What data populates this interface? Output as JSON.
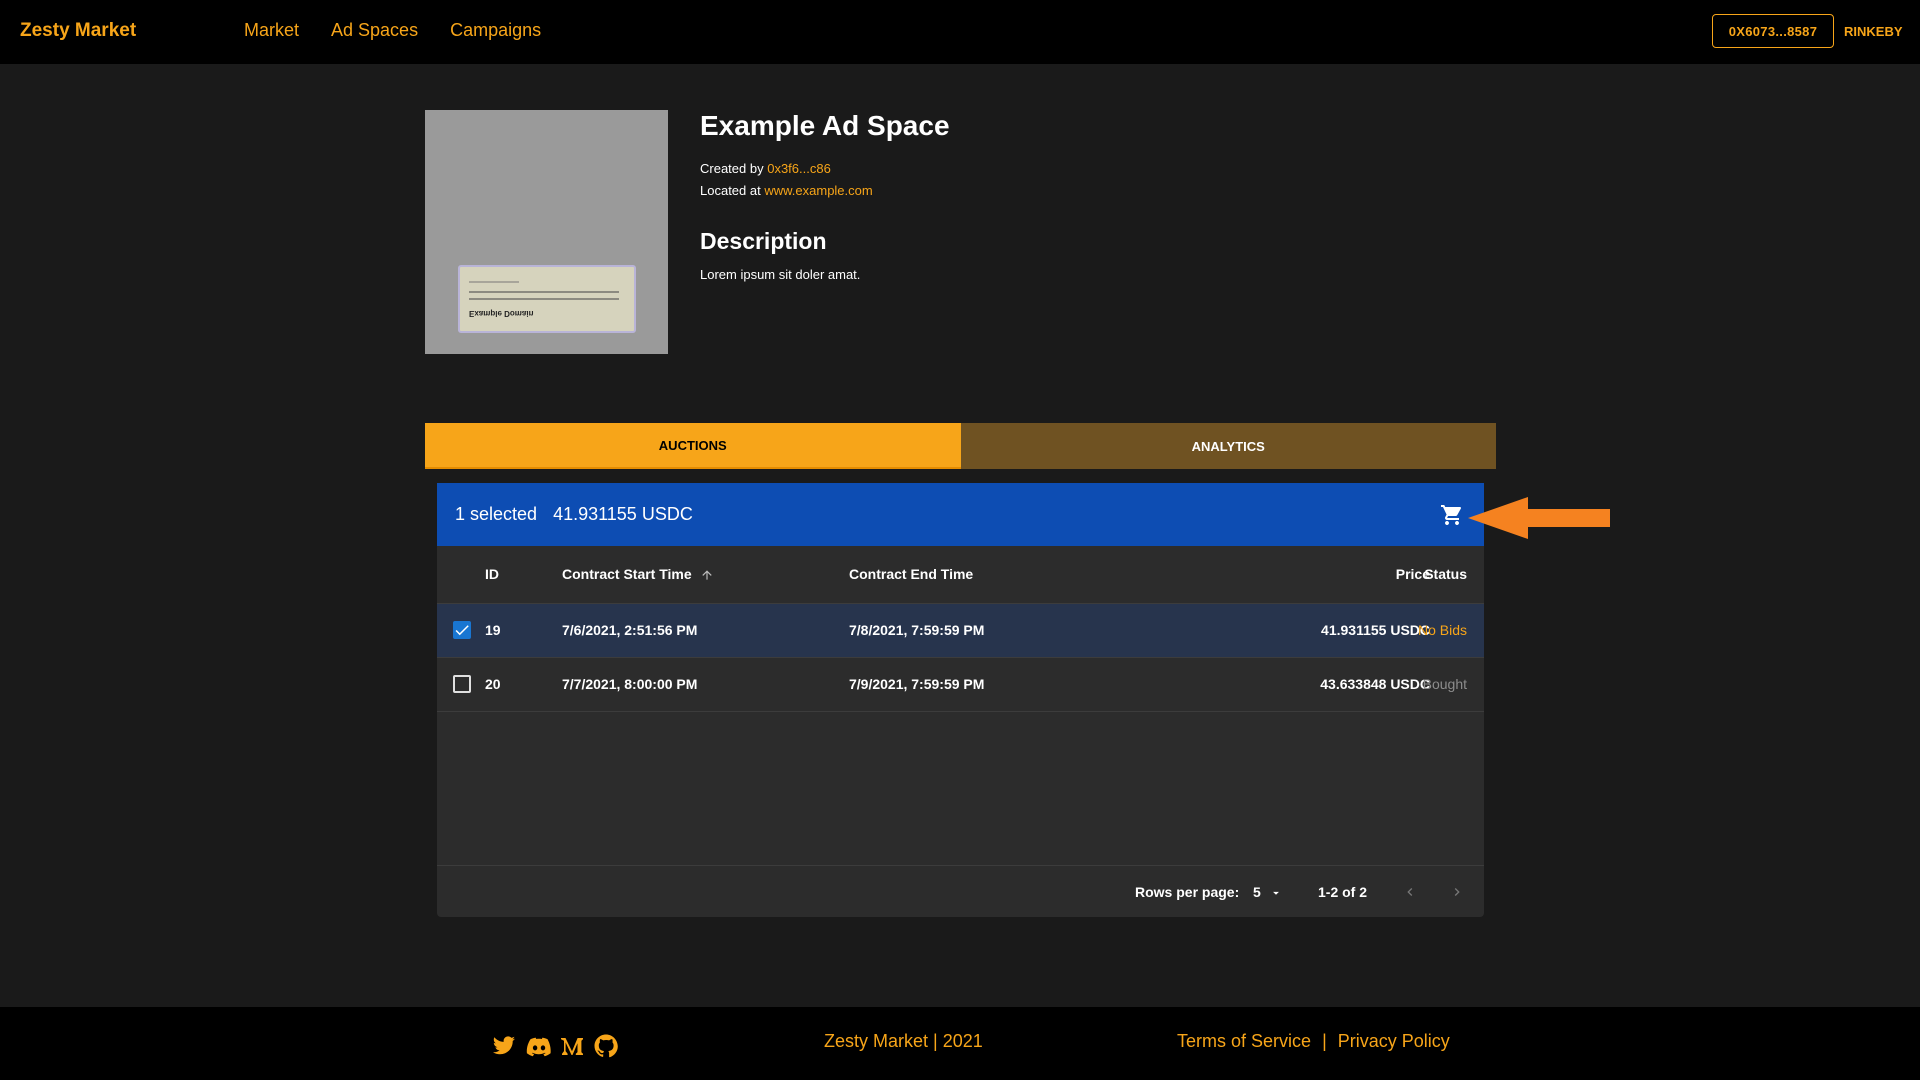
{
  "header": {
    "brand": "Zesty Market",
    "nav": [
      "Market",
      "Ad Spaces",
      "Campaigns"
    ],
    "wallet": "0X6073...8587",
    "network": "RINKEBY"
  },
  "thumbnail": {
    "caption": "Example Domain"
  },
  "adspace": {
    "title": "Example Ad Space",
    "created_prefix": "Created by",
    "creator": "0x3f6...c86",
    "located_prefix": "Located at",
    "location": "www.example.com",
    "description_title": "Description",
    "description": "Lorem ipsum sit doler amat."
  },
  "tabs": [
    "AUCTIONS",
    "ANALYTICS"
  ],
  "selection": {
    "count": "1 selected",
    "total": "41.931155 USDC"
  },
  "table": {
    "columns": [
      "ID",
      "Contract Start Time",
      "Contract End Time",
      "Price",
      "Status"
    ],
    "rows": [
      {
        "id": "19",
        "start": "7/6/2021, 2:51:56 PM",
        "end": "7/8/2021, 7:59:59 PM",
        "price": "41.931155 USDC",
        "status": "No Bids"
      },
      {
        "id": "20",
        "start": "7/7/2021, 8:00:00 PM",
        "end": "7/9/2021, 7:59:59 PM",
        "price": "43.633848 USDC",
        "status": "Bought"
      }
    ],
    "rows_per_page_label": "Rows per page:",
    "rows_per_page": "5",
    "range": "1-2 of 2"
  },
  "footer": {
    "copyright": "Zesty Market | 2021",
    "terms": "Terms of Service",
    "separator": "|",
    "privacy": "Privacy Policy"
  },
  "colors": {
    "accent": "#f7a519",
    "selection_bar": "#0d4db3",
    "annotation_arrow": "#f58220"
  }
}
